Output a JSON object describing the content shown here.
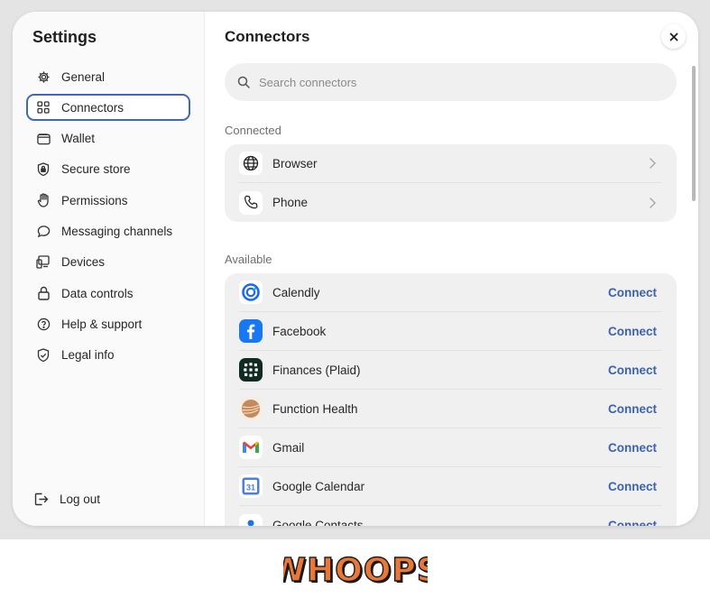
{
  "sidebar": {
    "title": "Settings",
    "items": [
      {
        "label": "General",
        "icon": "gear-icon",
        "active": false
      },
      {
        "label": "Connectors",
        "icon": "grid-icon",
        "active": true
      },
      {
        "label": "Wallet",
        "icon": "wallet-icon",
        "active": false
      },
      {
        "label": "Secure store",
        "icon": "shield-lock-icon",
        "active": false
      },
      {
        "label": "Permissions",
        "icon": "hand-icon",
        "active": false
      },
      {
        "label": "Messaging channels",
        "icon": "chat-bubble-icon",
        "active": false
      },
      {
        "label": "Devices",
        "icon": "devices-icon",
        "active": false
      },
      {
        "label": "Data controls",
        "icon": "lock-icon",
        "active": false
      },
      {
        "label": "Help & support",
        "icon": "help-circle-icon",
        "active": false
      },
      {
        "label": "Legal info",
        "icon": "shield-check-icon",
        "active": false
      }
    ],
    "logout_label": "Log out"
  },
  "main": {
    "title": "Connectors",
    "search_placeholder": "Search connectors",
    "connected_label": "Connected",
    "connected": [
      {
        "name": "Browser",
        "icon": "globe-icon"
      },
      {
        "name": "Phone",
        "icon": "phone-icon"
      }
    ],
    "available_label": "Available",
    "available": [
      {
        "name": "Calendly",
        "icon": "calendly-icon",
        "action": "Connect"
      },
      {
        "name": "Facebook",
        "icon": "facebook-icon",
        "action": "Connect"
      },
      {
        "name": "Finances (Plaid)",
        "icon": "plaid-icon",
        "action": "Connect"
      },
      {
        "name": "Function Health",
        "icon": "function-health-icon",
        "action": "Connect"
      },
      {
        "name": "Gmail",
        "icon": "gmail-icon",
        "action": "Connect"
      },
      {
        "name": "Google Calendar",
        "icon": "google-calendar-icon",
        "action": "Connect"
      },
      {
        "name": "Google Contacts",
        "icon": "google-contacts-icon",
        "action": "Connect"
      }
    ],
    "calendar_day": "31"
  },
  "footer": {
    "logo_text": "WHOOPS"
  },
  "colors": {
    "accent": "#3d61b3",
    "active_border": "#3f68b6",
    "facebook": "#1877f2"
  }
}
